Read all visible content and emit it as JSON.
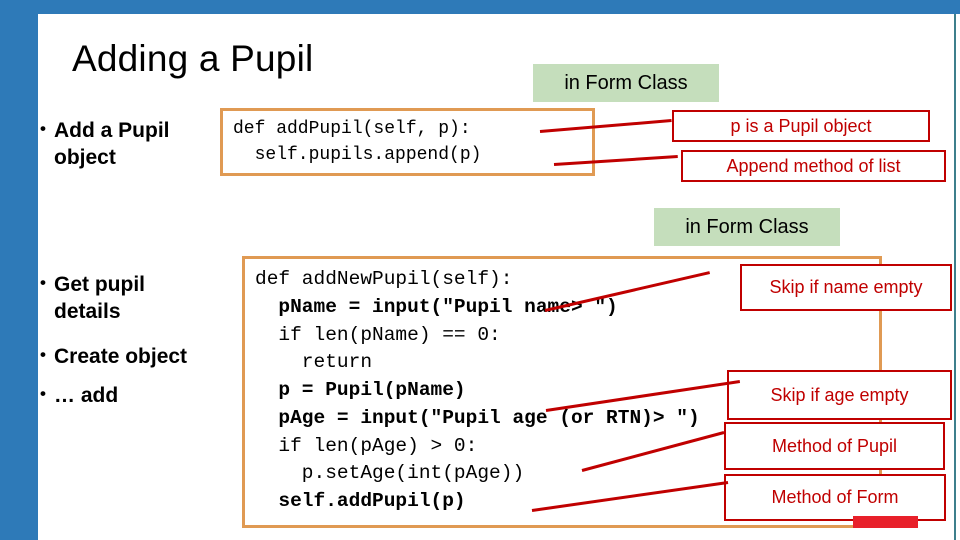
{
  "slide": {
    "title": "Adding a Pupil",
    "accent_blue": "#2e7ab8",
    "accent_orange": "#e09a53",
    "accent_red": "#c00000",
    "accent_green": "#c5debc"
  },
  "bullets": [
    {
      "id": "add",
      "marker": "•",
      "text": "Add a Pupil object"
    },
    {
      "id": "get",
      "marker": "•",
      "text": "Get pupil details"
    },
    {
      "id": "create",
      "marker": "•",
      "text": "Create object"
    },
    {
      "id": "dots",
      "marker": "•",
      "text": "… add"
    }
  ],
  "code_add_pupil": {
    "lines": [
      {
        "text": "def addPupil(self, p):",
        "bold": false
      },
      {
        "text": "  self.pupils.append(p)",
        "bold": false
      }
    ]
  },
  "code_add_new_pupil": {
    "lines": [
      {
        "text": "def addNewPupil(self):",
        "bold": false
      },
      {
        "text": "  pName = input(\"Pupil name> \")",
        "bold": true
      },
      {
        "text": "  if len(pName) == 0:",
        "bold": false
      },
      {
        "text": "    return",
        "bold": false
      },
      {
        "text": "  p = Pupil(pName)",
        "bold": true
      },
      {
        "text": "  pAge = input(\"Pupil age (or RTN)> \")",
        "bold": true
      },
      {
        "text": "  if len(pAge) > 0:",
        "bold": false
      },
      {
        "text": "    p.setAge(int(pAge))",
        "bold": false
      },
      {
        "text": "  self.addPupil(p)",
        "bold": true
      }
    ]
  },
  "green_labels": [
    {
      "id": "form-class-1",
      "text": "in Form Class"
    },
    {
      "id": "form-class-2",
      "text": "in Form Class"
    }
  ],
  "red_labels": [
    {
      "id": "p-is-pupil",
      "text": "p is a Pupil object"
    },
    {
      "id": "append-method",
      "text": "Append method of list"
    },
    {
      "id": "skip-name",
      "text": "Skip if name empty"
    },
    {
      "id": "skip-age",
      "text": "Skip if age empty"
    },
    {
      "id": "method-pupil",
      "text": "Method of Pupil"
    },
    {
      "id": "method-form",
      "text": "Method of Form"
    }
  ]
}
